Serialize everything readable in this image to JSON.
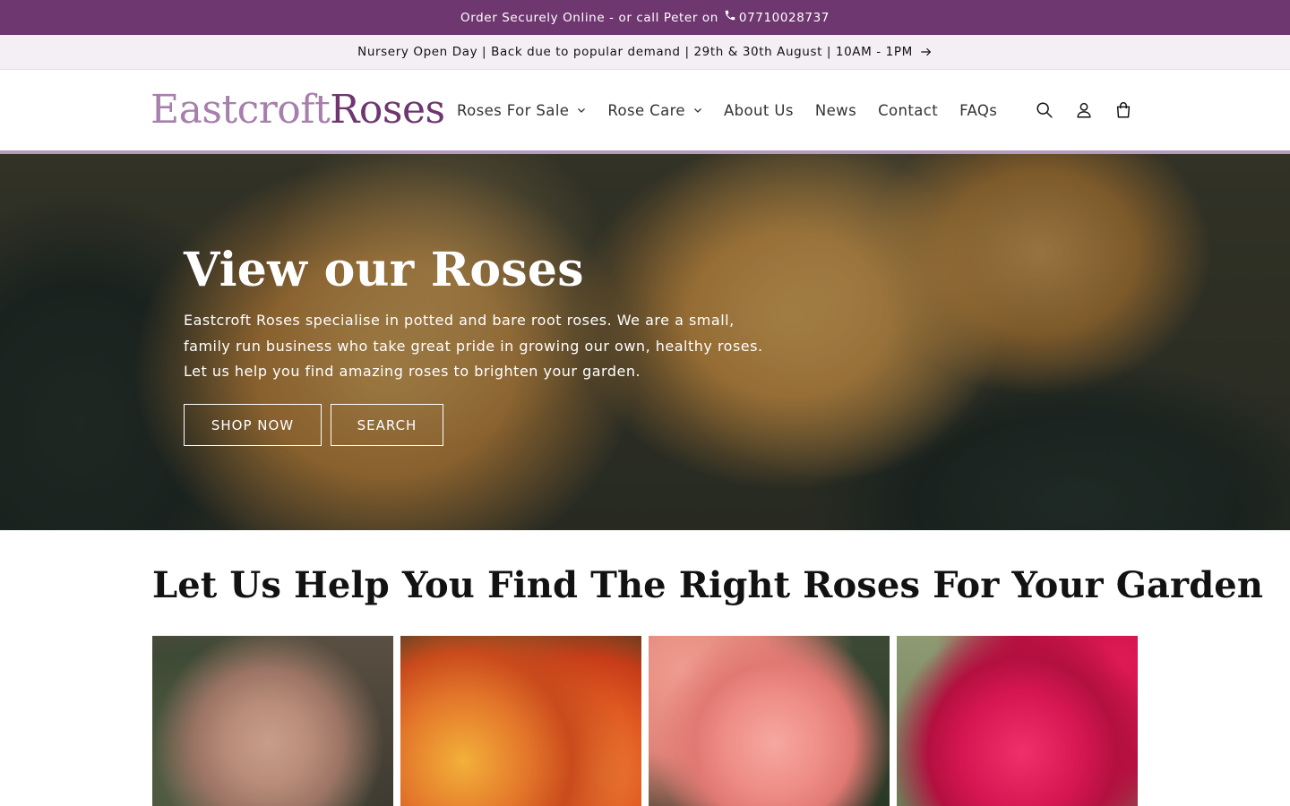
{
  "topbar": {
    "text": "Order Securely Online - or call Peter on",
    "phone": "07710028737",
    "icon": "phone-icon"
  },
  "announcement": {
    "text": "Nursery Open Day | Back due to popular demand | 29th & 30th August | 10AM - 1PM",
    "icon": "arrow-right-icon"
  },
  "logo": {
    "part1": "Eastcroft",
    "part2": "Roses"
  },
  "nav": {
    "items": [
      {
        "label": "Roses For Sale",
        "dropdown": true
      },
      {
        "label": "Rose Care",
        "dropdown": true
      },
      {
        "label": "About Us",
        "dropdown": false
      },
      {
        "label": "News",
        "dropdown": false
      },
      {
        "label": "Contact",
        "dropdown": false
      },
      {
        "label": "FAQs",
        "dropdown": false
      }
    ]
  },
  "header_icons": [
    "search-icon",
    "account-icon",
    "cart-icon"
  ],
  "hero": {
    "title": "View our Roses",
    "text_lines": [
      "Eastcroft Roses specialise in potted and bare root roses. We are a small,",
      "family run business who take great pride in growing our own, healthy roses.",
      "Let us help you find amazing roses to brighten your garden."
    ],
    "buttons": {
      "shop": "SHOP NOW",
      "search": "SEARCH"
    }
  },
  "section": {
    "title": "Let Us Help You Find The Right Roses For Your Garden"
  },
  "colors": {
    "topbar_bg": "#6e3770",
    "announcement_bg": "#f3eff4",
    "logo_light": "#a77fad",
    "logo_dark": "#6e3770",
    "header_rule": "#b79ac0"
  }
}
